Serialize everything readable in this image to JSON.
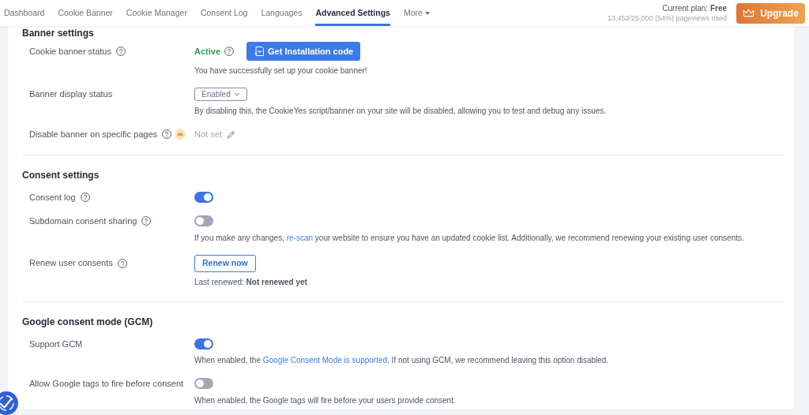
{
  "nav": {
    "tabs": [
      {
        "label": "Dashboard",
        "selected": false,
        "kind": "tab"
      },
      {
        "label": "Cookie Banner",
        "selected": false,
        "kind": "tab"
      },
      {
        "label": "Cookie Manager",
        "selected": false,
        "kind": "tab"
      },
      {
        "label": "Consent Log",
        "selected": false,
        "kind": "tab"
      },
      {
        "label": "Languages",
        "selected": false,
        "kind": "tab"
      },
      {
        "label": "Advanced Settings",
        "selected": true,
        "kind": "tab"
      },
      {
        "label": "More",
        "selected": false,
        "kind": "dropdown"
      }
    ]
  },
  "plan": {
    "label": "Current plan: **Free**",
    "usage": "13,452/25,000 (54%) pageviews used"
  },
  "upgrade_button": {
    "label": "Upgrade"
  },
  "sections": [
    {
      "title": "Banner settings",
      "rows": [
        {
          "kind": "status",
          "label": "Cookie banner status",
          "help": true,
          "premium": false,
          "status": "Active",
          "button": "Get Installation code",
          "note": [
            {
              "kind": "text",
              "text": "You have successfully set up your cookie banner!"
            }
          ]
        },
        {
          "kind": "dropdown",
          "label": "Banner display status",
          "help": false,
          "premium": false,
          "value": "Enabled",
          "note": [
            {
              "kind": "text",
              "text": "By disabling this, the CookieYes script/banner on your site will be disabled, allowing you to test and debug any issues."
            }
          ]
        },
        {
          "kind": "edit",
          "label": "Disable banner on specific pages",
          "help": true,
          "premium": true,
          "value": "Not set"
        }
      ]
    },
    {
      "title": "Consent settings",
      "rows": [
        {
          "kind": "toggle",
          "label": "Consent log",
          "help": true,
          "premium": false,
          "on": true
        },
        {
          "kind": "toggle",
          "label": "Subdomain consent sharing",
          "help": true,
          "premium": false,
          "on": false,
          "note": [
            {
              "kind": "text",
              "text": "If you make any changes, "
            },
            {
              "kind": "link",
              "text": "re-scan"
            },
            {
              "kind": "text",
              "text": " your website to ensure you have an updated cookie list. Additionally, we recommend renewing your existing user consents."
            }
          ]
        },
        {
          "kind": "button",
          "label": "Renew user consents",
          "help": true,
          "premium": false,
          "button": "Renew now",
          "note": [
            {
              "kind": "text",
              "text": "Last renewed: **Not renewed yet**"
            }
          ]
        }
      ]
    },
    {
      "title": "Google consent mode (GCM)",
      "rows": [
        {
          "kind": "toggle",
          "label": "Support GCM",
          "help": false,
          "premium": false,
          "on": true,
          "note": [
            {
              "kind": "text",
              "text": "When enabled, the "
            },
            {
              "kind": "link",
              "text": "Google Consent Mode is supported"
            },
            {
              "kind": "text",
              "text": ". If not using GCM, we recommend leaving this option disabled."
            }
          ]
        },
        {
          "kind": "toggle",
          "label": "Allow Google tags to fire before consent",
          "help": false,
          "premium": false,
          "on": false,
          "note": [
            {
              "kind": "text",
              "text": "When enabled, the Google tags will fire before your users provide consent."
            }
          ]
        }
      ]
    }
  ]
}
